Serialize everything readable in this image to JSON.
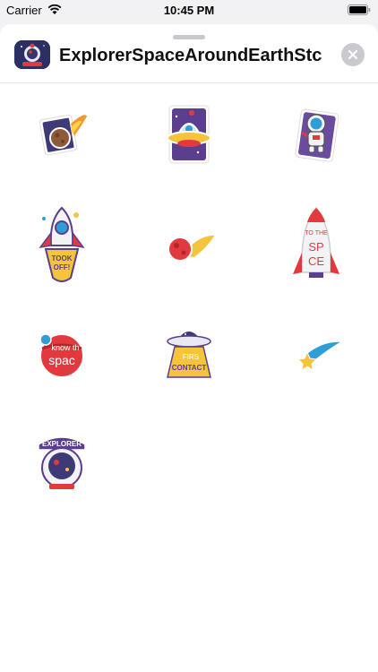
{
  "status_bar": {
    "carrier": "Carrier",
    "time": "10:45 PM",
    "icons": [
      "wifi-icon",
      "battery-icon"
    ]
  },
  "sheet": {
    "title": "ExplorerSpaceAroundEarthStc",
    "close_icon": "close-icon"
  },
  "stickers": [
    {
      "name": "comet-card"
    },
    {
      "name": "ufo-card"
    },
    {
      "name": "astronaut-card"
    },
    {
      "name": "rocket-took-off",
      "text": "TOOK OFF!"
    },
    {
      "name": "meteor"
    },
    {
      "name": "rocket-to-the-space",
      "text_top": "TO THE",
      "text_bottom": "SP CE"
    },
    {
      "name": "planet-know-the-space",
      "text_top": "know th",
      "text_bottom": "spac"
    },
    {
      "name": "ufo-first-contact",
      "text_top": "FIRS",
      "text_bottom": "CONTACT"
    },
    {
      "name": "shooting-star"
    },
    {
      "name": "explorer-helmet",
      "text": "EXPLORER"
    }
  ],
  "colors": {
    "sheet_bg": "#ffffff",
    "close_bg": "#c9c9ce",
    "purple": "#5b3f8f",
    "red": "#e2393f",
    "yellow": "#f6c43a",
    "blue": "#2f9ed6"
  }
}
